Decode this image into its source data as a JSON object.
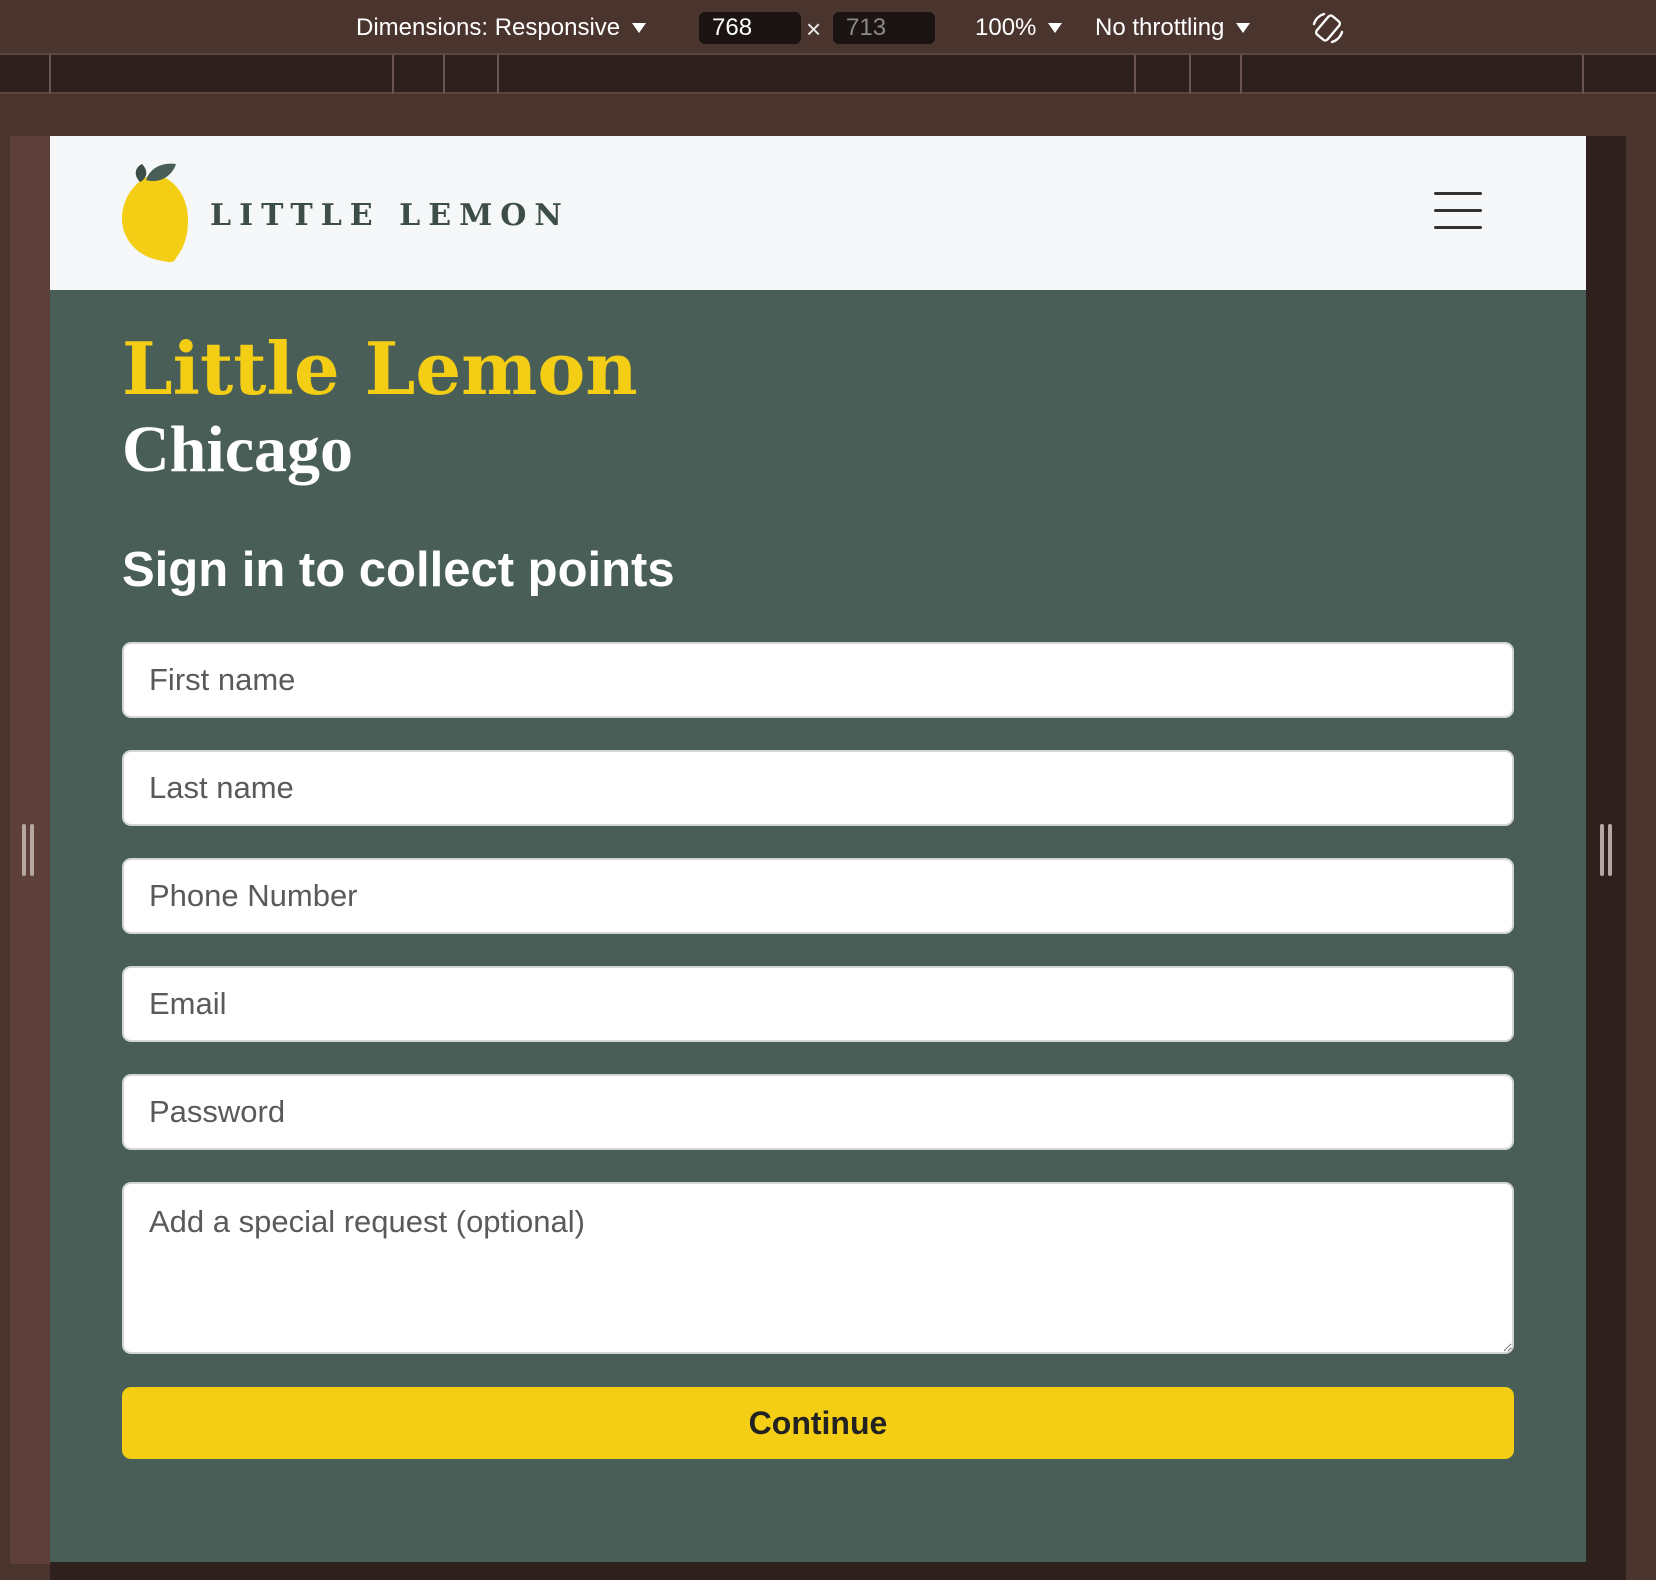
{
  "devtools": {
    "dimensions_label": "Dimensions: Responsive",
    "width_value": "768",
    "height_value": "713",
    "times_symbol": "×",
    "zoom_label": "100%",
    "throttling_label": "No throttling",
    "rotate_icon": "rotate-device-icon"
  },
  "header": {
    "logo_icon": "lemon-logo-icon",
    "logo_text": "LITTLE LEMON",
    "menu_icon": "hamburger-menu-icon"
  },
  "hero": {
    "title": "Little Lemon",
    "subtitle": "Chicago"
  },
  "form": {
    "heading": "Sign in to collect points",
    "first_name_placeholder": "First name",
    "last_name_placeholder": "Last name",
    "phone_placeholder": "Phone Number",
    "email_placeholder": "Email",
    "password_placeholder": "Password",
    "request_placeholder": "Add a special request (optional)",
    "submit_label": "Continue"
  },
  "colors": {
    "brand_green": "#495e57",
    "brand_yellow": "#f4ce14",
    "devtools_bg": "#4a342e"
  }
}
